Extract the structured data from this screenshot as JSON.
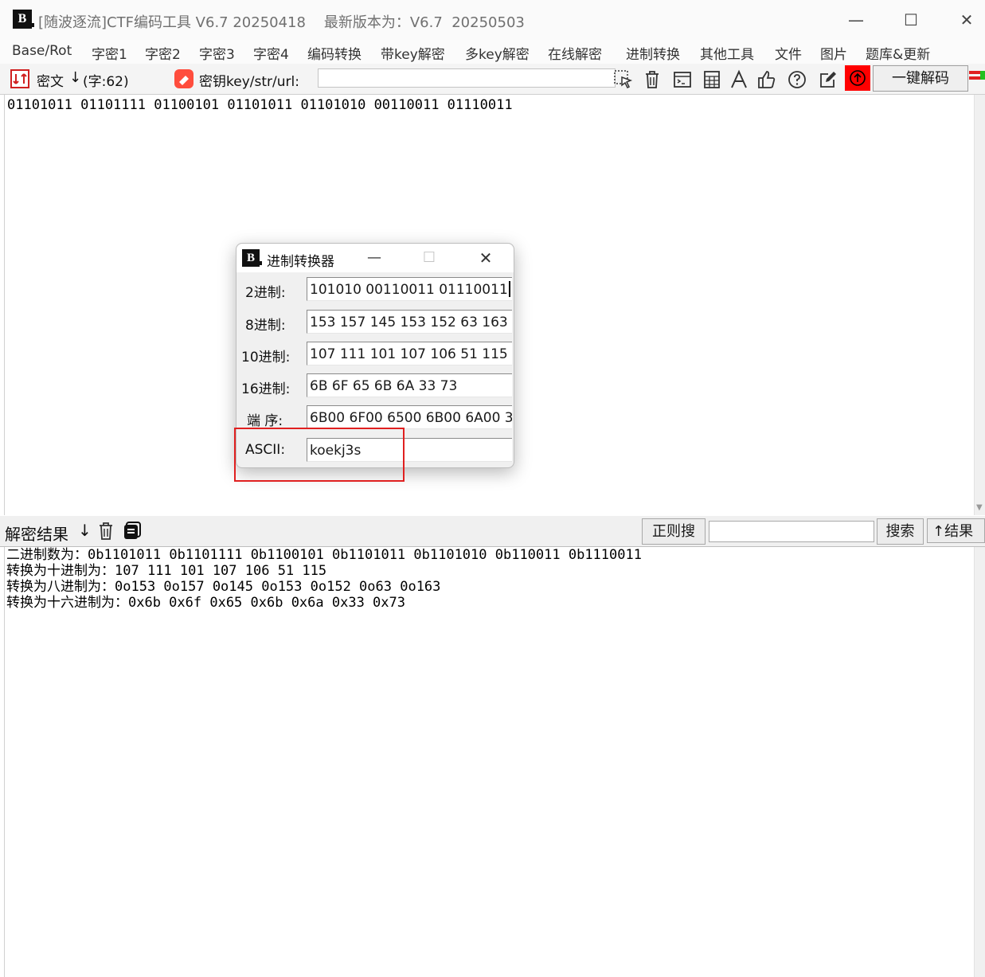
{
  "window": {
    "title": "[随波逐流]CTF编码工具 V6.7 20250418    最新版本为：V6.7  20250503",
    "logo_text": "B"
  },
  "menu": [
    "Base/Rot",
    "字密1",
    "字密2",
    "字密3",
    "字密4",
    "编码转换",
    "带key解密",
    "多key解密",
    "在线解密",
    "进制转换",
    "其他工具",
    "文件",
    "图片",
    "题库&更新"
  ],
  "toolbar": {
    "cipher_label": "密文",
    "char_count": "(字:62)",
    "key_label": "密钥key/str/url:",
    "key_value": "",
    "onekey_label": "一键解码"
  },
  "cipher": {
    "text": "01101011 01101111 01100101 01101011 01101010 00110011 01110011"
  },
  "result_bar": {
    "label": "解密结果",
    "regex_label": "正则搜",
    "search_value": "",
    "search_label": "搜索",
    "to_result_label": "↑结果"
  },
  "results": [
    "二进制数为：0b1101011 0b1101111 0b1100101 0b1101011 0b1101010 0b110011 0b1110011",
    "转换为十进制为：107 111 101 107 106 51 115",
    "转换为八进制为：0o153 0o157 0o145 0o153 0o152 0o63 0o163",
    "转换为十六进制为：0x6b 0x6f 0x65 0x6b 0x6a 0x33 0x73"
  ],
  "dialog": {
    "title": "进制转换器",
    "rows": [
      {
        "label": "2进制:",
        "value": "101010 00110011 01110011"
      },
      {
        "label": "8进制:",
        "value": "153 157 145 153 152 63 163"
      },
      {
        "label": "10进制:",
        "value": "107 111 101 107 106 51 115"
      },
      {
        "label": "16进制:",
        "value": "6B 6F 65 6B 6A 33 73"
      },
      {
        "label": "端 序:",
        "value": "6B00 6F00 6500 6B00 6A00 3"
      },
      {
        "label": "ASCII:",
        "value": "koekj3s"
      }
    ]
  },
  "colors": {
    "accent_red": "#e02020",
    "upload_button": "#ff0000"
  }
}
